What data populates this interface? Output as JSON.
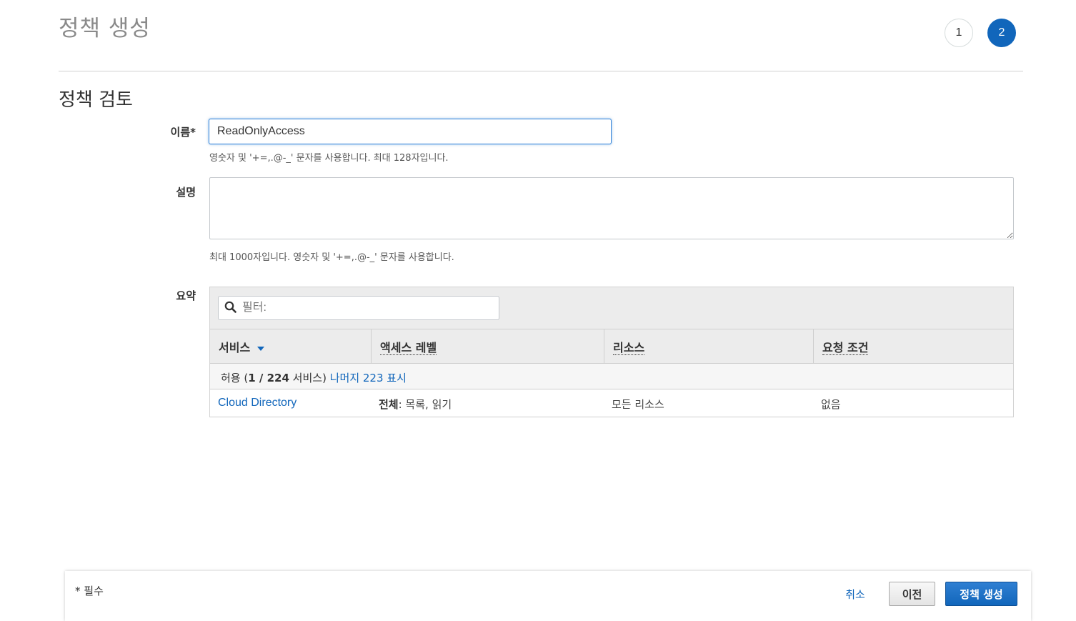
{
  "header": {
    "title": "정책 생성",
    "steps": [
      {
        "label": "1",
        "active": false
      },
      {
        "label": "2",
        "active": true
      }
    ]
  },
  "review": {
    "section_title": "정책 검토",
    "name": {
      "label": "이름*",
      "value": "ReadOnlyAccess",
      "help": "영숫자 및 '+=,.@-_' 문자를 사용합니다. 최대 128자입니다."
    },
    "description": {
      "label": "설명",
      "value": "",
      "help": "최대 1000자입니다. 영숫자 및 '+=,.@-_' 문자를 사용합니다."
    },
    "summary": {
      "label": "요약",
      "filter_placeholder": "필터:",
      "columns": [
        "서비스",
        "액세스 레벨",
        "리소스",
        "요청 조건"
      ],
      "group": {
        "prefix": "허용 (",
        "count": "1 / 224",
        "suffix": " 서비스)",
        "link": "나머지 223 표시"
      },
      "rows": [
        {
          "service": "Cloud Directory",
          "access_level_bold": "전체",
          "access_level_rest": ": 목록, 읽기",
          "resource": "모든 리소스",
          "conditions": "없음"
        }
      ]
    }
  },
  "footer": {
    "required_note": "* 필수",
    "cancel": "취소",
    "previous": "이전",
    "create": "정책 생성"
  },
  "colors": {
    "accent": "#1166bb",
    "table_header_bg": "#ececec"
  }
}
